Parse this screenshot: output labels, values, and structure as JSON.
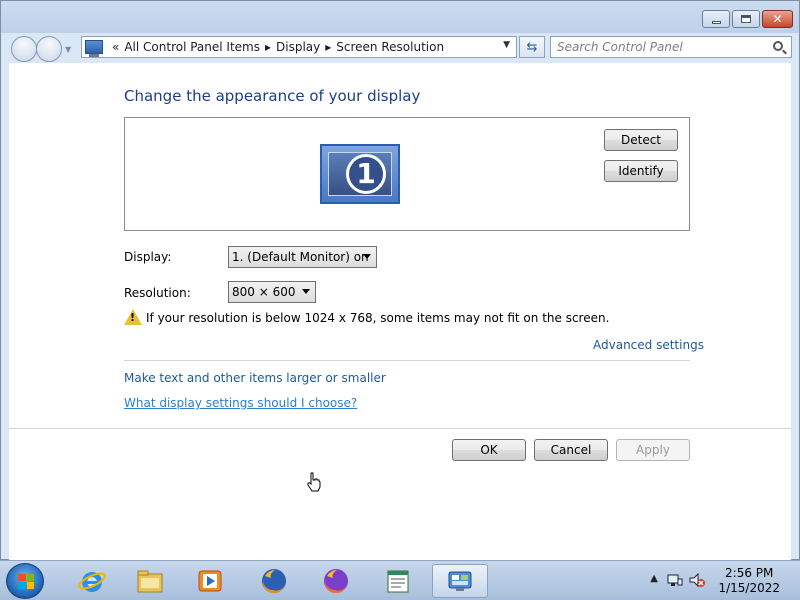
{
  "window": {
    "buttons": {
      "minimize": "minimize",
      "maximize": "maximize",
      "close": "close"
    }
  },
  "address": {
    "breadcrumbs": [
      "All Control Panel Items",
      "Display",
      "Screen Resolution"
    ],
    "search_placeholder": "Search Control Panel"
  },
  "main": {
    "heading": "Change the appearance of your display",
    "monitor_number": "1",
    "detect_label": "Detect",
    "identify_label": "Identify",
    "display_label": "Display:",
    "display_value": "1. (Default Monitor) on",
    "resolution_label": "Resolution:",
    "resolution_value": "800 × 600",
    "warning_text": "If your resolution is below 1024 x 768, some items may not fit on the screen.",
    "advanced_link": "Advanced settings",
    "text_size_link": "Make text and other items larger or smaller",
    "help_link": "What display settings should I choose?"
  },
  "footer": {
    "ok_label": "OK",
    "cancel_label": "Cancel",
    "apply_label": "Apply"
  },
  "taskbar": {
    "items": [
      "internet-explorer-icon",
      "windows-explorer-icon",
      "media-player-icon",
      "firefox-icon",
      "firefox-icon",
      "notepad-icon",
      "control-panel-icon"
    ],
    "time": "2:56 PM",
    "date": "1/15/2022"
  }
}
